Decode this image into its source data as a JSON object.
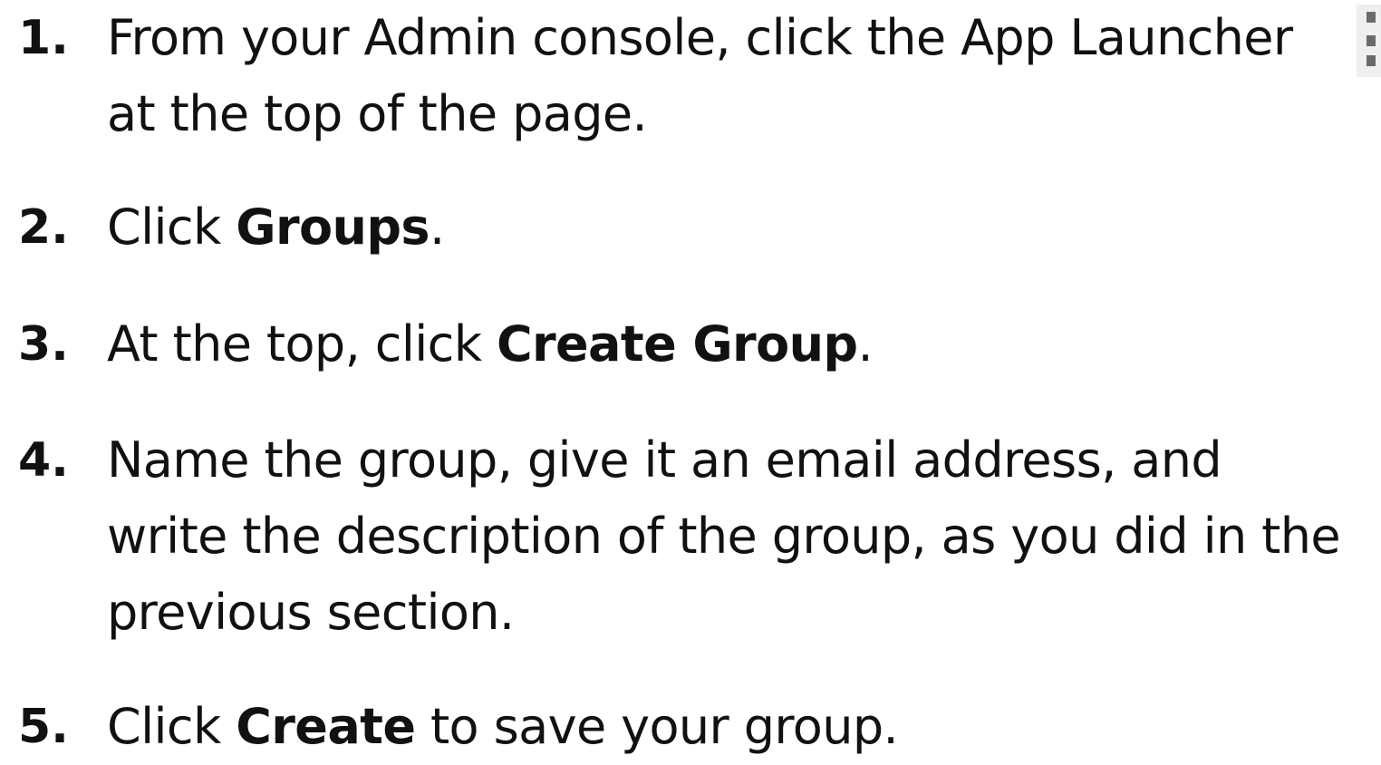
{
  "steps": [
    {
      "number": "1.",
      "line1": "From your Admin console, click the App Launcher",
      "line2": "at the top of the page."
    },
    {
      "number": "2.",
      "before": "Click ",
      "bold": "Groups",
      "after": "."
    },
    {
      "number": "3.",
      "before": "At the top, click ",
      "bold": "Create Group",
      "after": "."
    },
    {
      "number": "4.",
      "line1": "Name the group, give it an email address, and",
      "line2": "write the description of the group, as you did in the",
      "line3": "previous section."
    },
    {
      "number": "5.",
      "before": "Click ",
      "bold": "Create",
      "after": " to save your group."
    }
  ],
  "icons": {
    "app_launcher": "app-launcher-icon"
  }
}
